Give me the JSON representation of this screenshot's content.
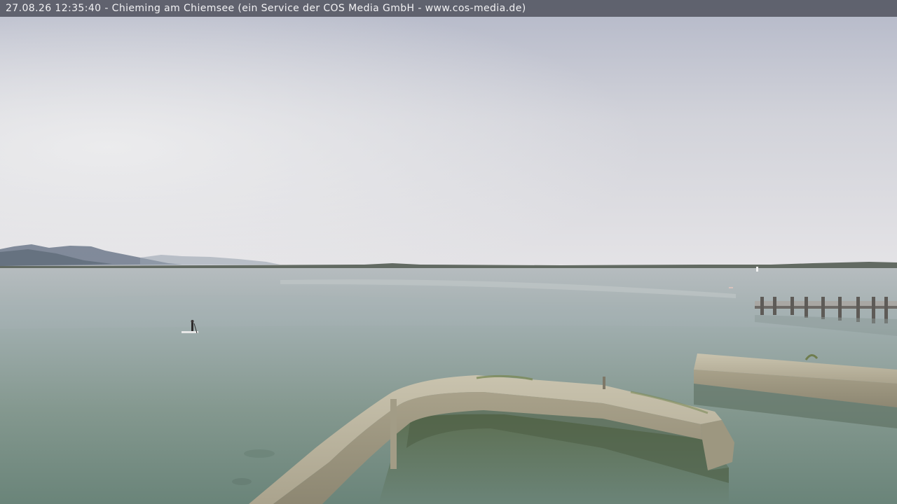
{
  "overlay": {
    "timestamp": "27.08.26 12:35:40",
    "separator": " - ",
    "caption": "Chieming am Chiemsee (ein Service der COS Media GmbH - www.cos-media.de)"
  },
  "scene": {
    "subject": "webcam-lake-view",
    "colors": {
      "sky_top": "#b7bac8",
      "sky_bottom": "#e2e2e6",
      "water_far": "#aab4b6",
      "water_near": "#6e8a82",
      "wall": "#b8b29e",
      "mountains": "#6f7a8a"
    }
  }
}
